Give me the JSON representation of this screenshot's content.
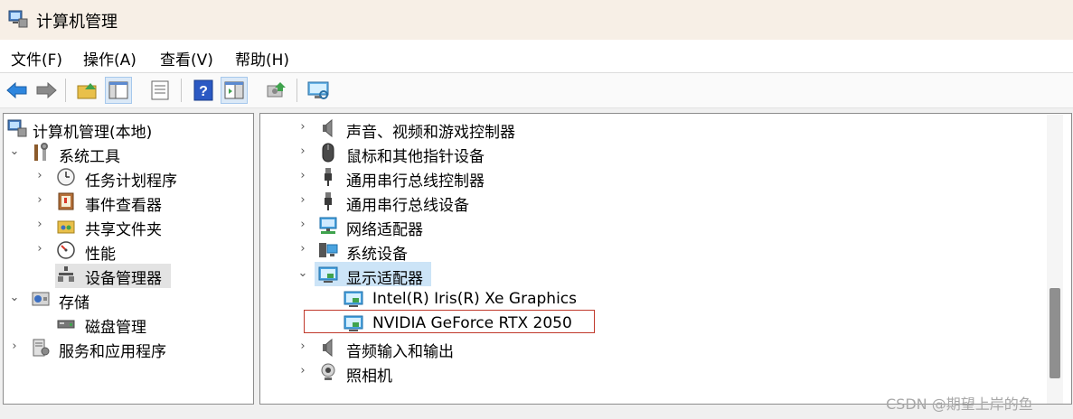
{
  "window": {
    "title": "计算机管理"
  },
  "menu": [
    "文件(F)",
    "操作(A)",
    "查看(V)",
    "帮助(H)"
  ],
  "toolbar": [
    {
      "icon": "back-arrow-icon"
    },
    {
      "icon": "forward-arrow-icon"
    },
    {
      "icon": "up-folder-icon"
    },
    {
      "icon": "show-hide-tree-icon"
    },
    {
      "icon": "properties-icon"
    },
    {
      "icon": "help-icon"
    },
    {
      "icon": "show-hide-action-pane-icon"
    },
    {
      "icon": "update-driver-icon"
    },
    {
      "icon": "scan-hardware-icon"
    }
  ],
  "left_tree": [
    {
      "label": "计算机管理(本地)",
      "icon": "computer-management-icon",
      "expander": ""
    },
    {
      "label": "系统工具",
      "icon": "system-tools-icon",
      "expander": "expanded"
    },
    {
      "label": "任务计划程序",
      "icon": "clock-icon",
      "expander": "collapsed"
    },
    {
      "label": "事件查看器",
      "icon": "event-viewer-icon",
      "expander": "collapsed"
    },
    {
      "label": "共享文件夹",
      "icon": "shared-folder-icon",
      "expander": "collapsed"
    },
    {
      "label": "性能",
      "icon": "performance-icon",
      "expander": "collapsed"
    },
    {
      "label": "设备管理器",
      "icon": "device-manager-icon",
      "expander": "",
      "selected": true
    },
    {
      "label": "存储",
      "icon": "storage-icon",
      "expander": "expanded"
    },
    {
      "label": "磁盘管理",
      "icon": "disk-management-icon",
      "expander": ""
    },
    {
      "label": "服务和应用程序",
      "icon": "services-apps-icon",
      "expander": "collapsed"
    }
  ],
  "device_tree": [
    {
      "label": "声音、视频和游戏控制器",
      "icon": "speaker-icon",
      "expander": "collapsed"
    },
    {
      "label": "鼠标和其他指针设备",
      "icon": "mouse-icon",
      "expander": "collapsed"
    },
    {
      "label": "通用串行总线控制器",
      "icon": "usb-icon",
      "expander": "collapsed"
    },
    {
      "label": "通用串行总线设备",
      "icon": "usb-icon",
      "expander": "collapsed"
    },
    {
      "label": "网络适配器",
      "icon": "network-adapter-icon",
      "expander": "collapsed"
    },
    {
      "label": "系统设备",
      "icon": "system-device-icon",
      "expander": "collapsed"
    },
    {
      "label": "显示适配器",
      "icon": "display-adapter-icon",
      "expander": "expanded",
      "selected": true
    },
    {
      "label": "Intel(R) Iris(R) Xe Graphics",
      "icon": "display-adapter-icon",
      "expander": ""
    },
    {
      "label": "NVIDIA GeForce RTX 2050",
      "icon": "display-adapter-icon",
      "expander": "",
      "highlighted": true
    },
    {
      "label": "音频输入和输出",
      "icon": "speaker-icon",
      "expander": "collapsed"
    },
    {
      "label": "照相机",
      "icon": "camera-icon",
      "expander": "collapsed"
    }
  ],
  "scroll": {
    "position": 0.6
  },
  "watermark": "CSDN @期望上岸的鱼"
}
